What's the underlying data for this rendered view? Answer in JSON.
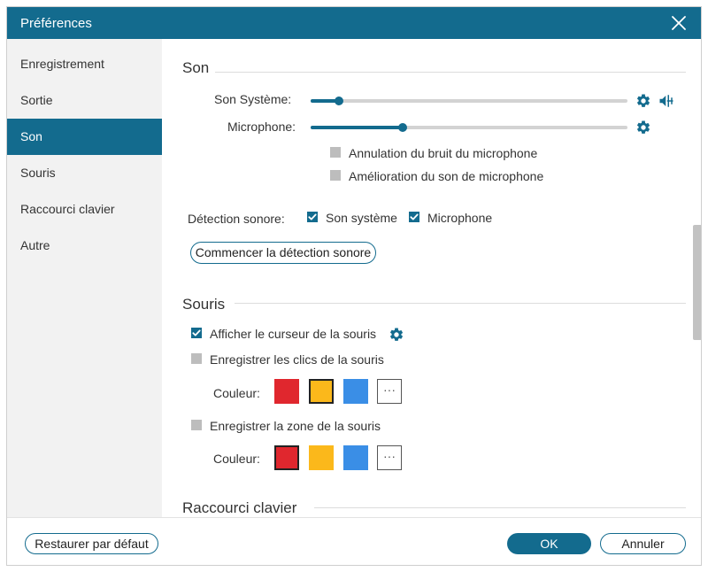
{
  "window": {
    "title": "Préférences"
  },
  "sidebar": {
    "items": [
      {
        "label": "Enregistrement"
      },
      {
        "label": "Sortie"
      },
      {
        "label": "Son"
      },
      {
        "label": "Souris"
      },
      {
        "label": "Raccourci clavier"
      },
      {
        "label": "Autre"
      }
    ],
    "active_index": 2
  },
  "son": {
    "title": "Son",
    "system_sound": {
      "label": "Son Système:",
      "value": 0.09
    },
    "microphone": {
      "label": "Microphone:",
      "value": 0.29
    },
    "noise_cancel": {
      "label": "Annulation du bruit du microphone",
      "checked": false
    },
    "enhance": {
      "label": "Amélioration du son de microphone",
      "checked": false
    },
    "detection": {
      "label": "Détection sonore:",
      "system_label": "Son système",
      "system_checked": true,
      "mic_label": "Microphone",
      "mic_checked": true,
      "start_button": "Commencer la détection sonore"
    }
  },
  "souris": {
    "title": "Souris",
    "show_cursor": {
      "label": "Afficher le curseur de la souris",
      "checked": true
    },
    "record_clicks": {
      "label": "Enregistrer les clics de la souris",
      "checked": false
    },
    "clicks_color": {
      "label": "Couleur:",
      "swatches": [
        "#e0272e",
        "#fbb81b",
        "#3a8ee6"
      ],
      "selected": 1,
      "more_label": "···"
    },
    "record_zone": {
      "label": "Enregistrer la zone de la souris",
      "checked": false
    },
    "zone_color": {
      "label": "Couleur:",
      "swatches": [
        "#e0272e",
        "#fbb81b",
        "#3a8ee6"
      ],
      "selected": 0,
      "more_label": "···"
    }
  },
  "raccourci": {
    "title": "Raccourci clavier"
  },
  "footer": {
    "restore_button": "Restaurer par défaut",
    "ok_button": "OK",
    "cancel_button": "Annuler"
  },
  "colors": {
    "accent": "#136b8e",
    "sidebar_bg": "#f2f2f2",
    "unchecked_box": "#bdbdbd"
  },
  "icons": [
    "close-icon",
    "gear-icon",
    "volume-icon",
    "checkmark-icon",
    "more-icon"
  ]
}
